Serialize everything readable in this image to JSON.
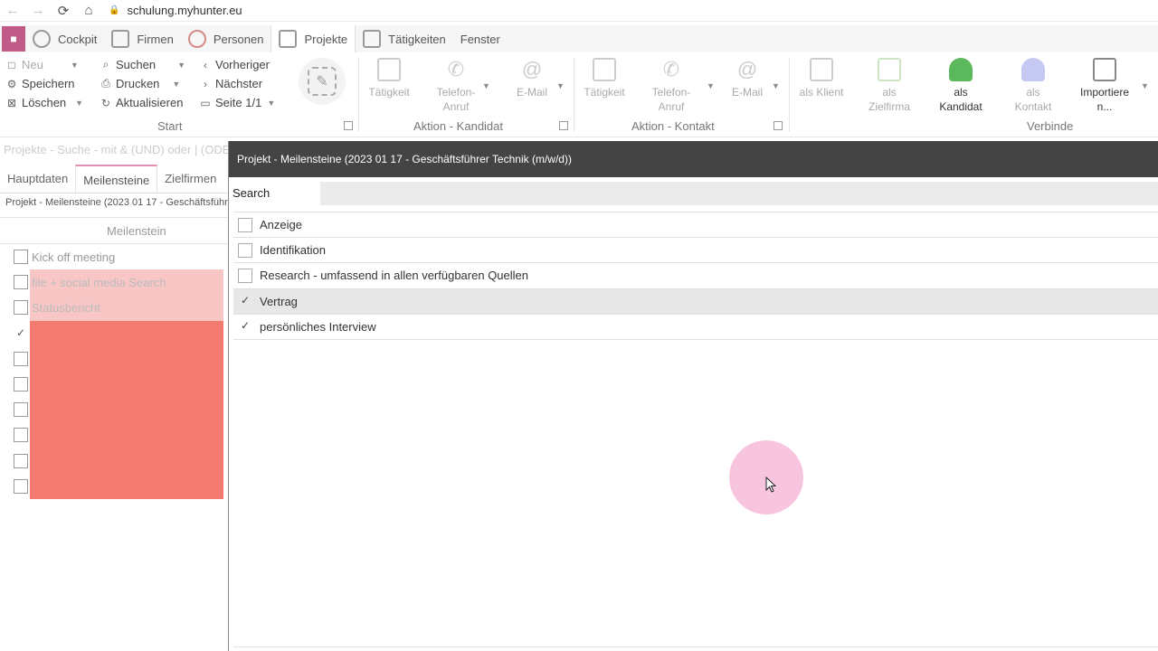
{
  "browser": {
    "url": "schulung.myhunter.eu",
    "back_glyph": "←",
    "forward_glyph": "→",
    "reload_glyph": "⟳",
    "home_glyph": "⌂",
    "lock_glyph": "🔒"
  },
  "menu": {
    "items": [
      {
        "label": "Cockpit"
      },
      {
        "label": "Firmen"
      },
      {
        "label": "Personen"
      },
      {
        "label": "Projekte"
      },
      {
        "label": "Tätigkeiten"
      },
      {
        "label": "Fenster"
      }
    ]
  },
  "ribbon": {
    "start": {
      "neu": "Neu",
      "speichern": "Speichern",
      "loeschen": "Löschen",
      "suchen": "Suchen",
      "drucken": "Drucken",
      "aktualisieren": "Aktualisieren",
      "vorheriger": "Vorheriger",
      "naechster": "Nächster",
      "seite": "Seite 1/1",
      "group": "Start"
    },
    "kandidat": {
      "taetigkeit": "Tätigkeit",
      "telefon": "Telefon-\nAnruf",
      "email": "E-Mail",
      "group": "Aktion - Kandidat"
    },
    "kontakt": {
      "taetigkeit": "Tätigkeit",
      "telefon": "Telefon-\nAnruf",
      "email": "E-Mail",
      "group": "Aktion - Kontakt"
    },
    "verbinde": {
      "als_klient": "als Klient",
      "als_zielfirma": "als\nZielfirma",
      "als_kandidat": "als\nKandidat",
      "als_kontakt": "als\nKontakt",
      "importieren": "Importiere\nn...",
      "group": "Verbinde"
    }
  },
  "left": {
    "crumb": "Projekte - Suche - mit & (UND) oder | (ODER",
    "tabs": [
      "Hauptdaten",
      "Meilensteine",
      "Zielfirmen"
    ],
    "subcrumb": "Projekt - Meilensteine (2023 01 17 - Geschäftsführ",
    "column_header": "Meilenstein",
    "milestones": [
      {
        "label": "Kick off meeting",
        "style": "plain",
        "checked": false
      },
      {
        "label": "file + social media Search",
        "style": "light",
        "checked": false
      },
      {
        "label": "Statusbericht",
        "style": "light",
        "checked": false
      },
      {
        "label": "",
        "style": "red",
        "checked": true
      },
      {
        "label": "",
        "style": "red",
        "checked": false
      },
      {
        "label": "",
        "style": "red",
        "checked": false
      },
      {
        "label": "",
        "style": "red",
        "checked": false
      },
      {
        "label": "",
        "style": "red",
        "checked": false
      },
      {
        "label": "",
        "style": "red",
        "checked": false
      },
      {
        "label": "",
        "style": "red",
        "checked": false
      }
    ]
  },
  "dialog": {
    "title": "Projekt - Meilensteine (2023 01 17 - Geschäftsführer Technik (m/w/d))",
    "search_label": "Search",
    "search_value": "",
    "options": [
      {
        "label": "Anzeige",
        "checked": false,
        "selected": false
      },
      {
        "label": "Identifikation",
        "checked": false,
        "selected": false
      },
      {
        "label": "Research - umfassend in allen verfügbaren Quellen",
        "checked": false,
        "selected": false
      },
      {
        "label": "Vertrag",
        "checked": true,
        "selected": true
      },
      {
        "label": "persönliches Interview",
        "checked": true,
        "selected": false
      }
    ]
  },
  "colors": {
    "accent": "#e58cb3",
    "light_row": "#f9c6c6",
    "red_row": "#f47b6f",
    "title_bar": "#444444",
    "cursor_ring": "#f2a0c8"
  }
}
